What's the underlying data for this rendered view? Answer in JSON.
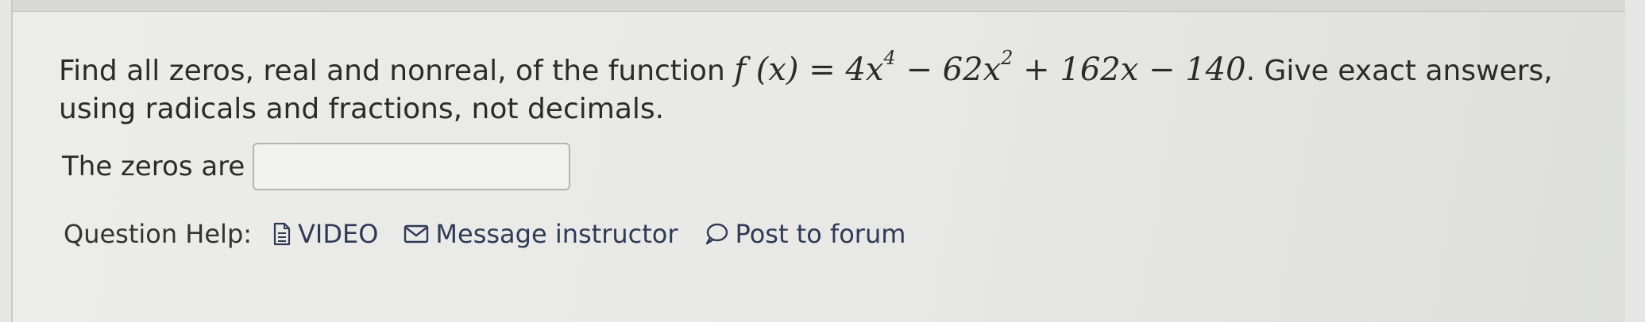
{
  "question": {
    "text_before": "Find all zeros, real and nonreal, of the function ",
    "function_lhs": "f (x) = 4x",
    "exp1": "4",
    "term2": " − 62x",
    "exp2": "2",
    "term3": " + 162x − 140",
    "text_after": ". Give exact answers, using radicals and fractions, not decimals."
  },
  "answer": {
    "label": "The zeros are",
    "value": ""
  },
  "help": {
    "label": "Question Help:",
    "video": "VIDEO",
    "message": "Message instructor",
    "forum": "Post to forum"
  },
  "icons": {
    "video": "document-icon",
    "message": "envelope-icon",
    "forum": "speech-bubble-icon"
  }
}
